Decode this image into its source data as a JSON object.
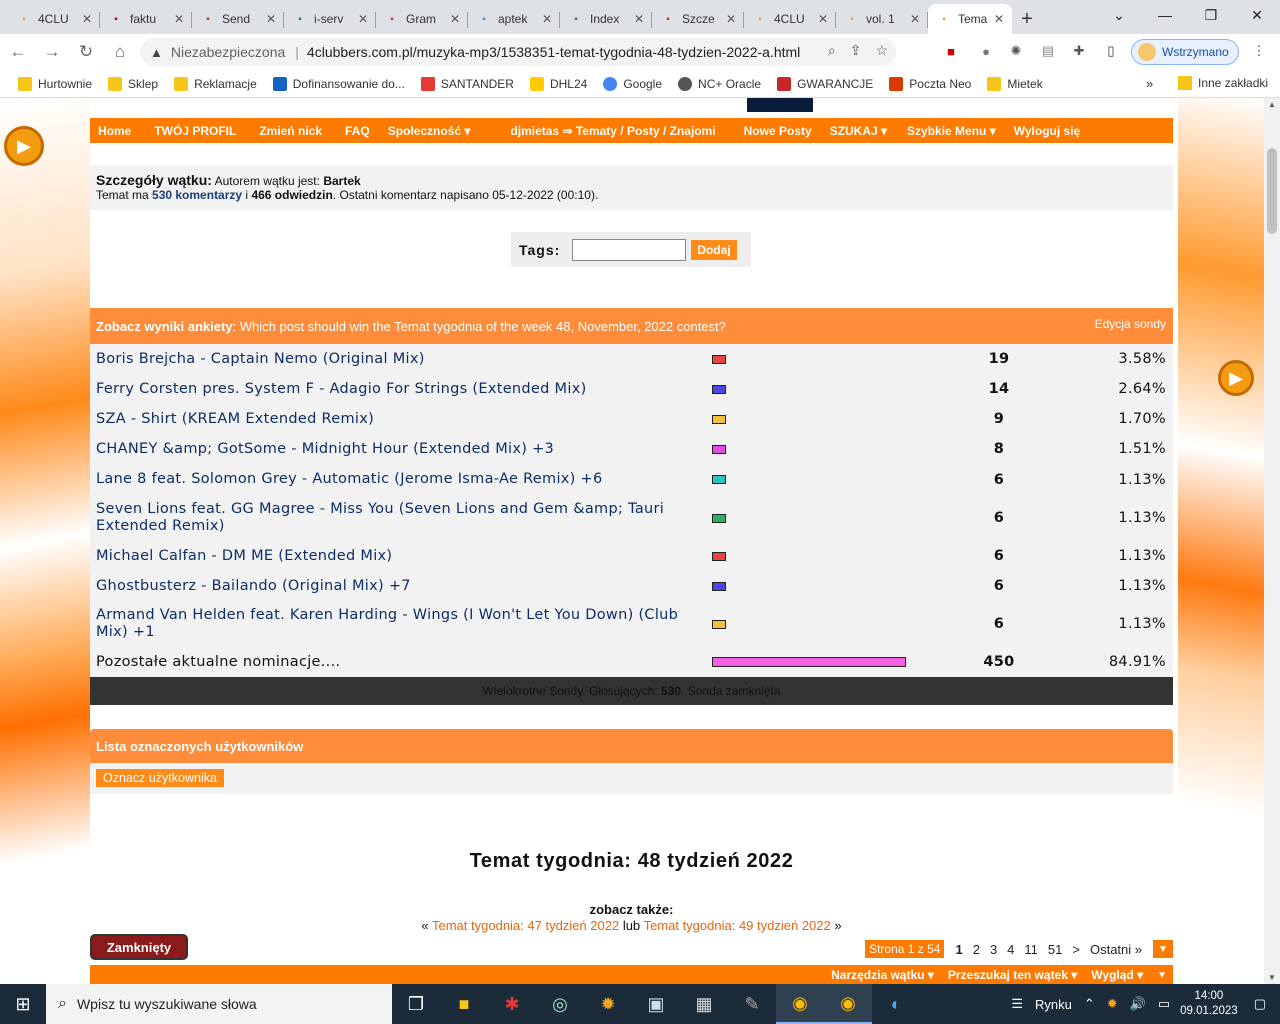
{
  "browser": {
    "tabs": [
      {
        "label": "4CLU",
        "icon": "4clubbers-favicon",
        "color": "#f5a623",
        "active": false
      },
      {
        "label": "faktu",
        "icon": "pdf-favicon",
        "color": "#c00000",
        "active": false
      },
      {
        "label": "Send",
        "icon": "sendit-favicon",
        "color": "#d32f2f",
        "active": false
      },
      {
        "label": "i-serv",
        "icon": "iserwis-favicon",
        "color": "#1a8f3c",
        "active": false
      },
      {
        "label": "Gram",
        "icon": "gram-favicon",
        "color": "#e53935",
        "active": false
      },
      {
        "label": "aptek",
        "icon": "google-favicon",
        "color": "#4285f4",
        "active": false
      },
      {
        "label": "Index",
        "icon": "globe-favicon",
        "color": "#666666",
        "active": false
      },
      {
        "label": "Szcze",
        "icon": "sendit-favicon",
        "color": "#d32f2f",
        "active": false
      },
      {
        "label": "4CLU",
        "icon": "4clubbers-favicon",
        "color": "#f5a623",
        "active": false
      },
      {
        "label": "vol. 1",
        "icon": "4clubbers-favicon",
        "color": "#f5a623",
        "active": false
      },
      {
        "label": "Tema",
        "icon": "4clubbers-favicon",
        "color": "#f5a623",
        "active": true
      }
    ],
    "new_tab": "+",
    "omnibox": {
      "security": "Niezabezpieczona",
      "url": "4clubbers.com.pl/muzyka-mp3/1538351-temat-tygodnia-48-tydzien-2022-a.html"
    },
    "profile_label": "Wstrzymano",
    "bookmarks": [
      {
        "label": "Hurtownie",
        "icon": "folder-icon"
      },
      {
        "label": "Sklep",
        "icon": "folder-icon"
      },
      {
        "label": "Reklamacje",
        "icon": "folder-icon"
      },
      {
        "label": "Dofinansowanie do...",
        "icon": "site-icon"
      },
      {
        "label": "SANTANDER",
        "icon": "santander-icon"
      },
      {
        "label": "DHL24",
        "icon": "dhl-icon"
      },
      {
        "label": "Google",
        "icon": "google-icon"
      },
      {
        "label": "NC+ Oracle",
        "icon": "globe-icon"
      },
      {
        "label": "GWARANCJE",
        "icon": "ergo-icon"
      },
      {
        "label": "Poczta Neo",
        "icon": "office-icon"
      },
      {
        "label": "Mietek",
        "icon": "folder-icon"
      }
    ],
    "bookmarks_more": "»",
    "other_bookmarks": "Inne zakładki"
  },
  "site": {
    "menu": [
      "Home",
      "TWÓJ PROFIL",
      "Zmień nick",
      "FAQ",
      "Społeczność ▾",
      "djmietas ⇒ Tematy / Posty / Znajomi",
      "Nowe Posty",
      "SZUKAJ ▾",
      "Szybkie Menu ▾",
      "Wyloguj się"
    ],
    "details": {
      "heading": "Szczegóły wątku:",
      "author_prefix": "Autorem wątku jest:",
      "author": "Bartek",
      "line2_prefix": "Temat ma",
      "comments": "530 komentarzy",
      "and": "i",
      "visits": "466 odwiedzin",
      "line2_suffix": ". Ostatni komentarz napisano 05-12-2022 (00:10)."
    },
    "tags": {
      "label": "Tags:",
      "button": "Dodaj",
      "value": ""
    },
    "poll": {
      "heading_bold": "Zobacz wyniki ankiety",
      "question": ": Which post should win the Temat tygodnia of the week 48, November, 2022 contest?",
      "edit": "Edycja sondy",
      "options": [
        {
          "label": "Boris Brejcha - Captain Nemo (Original Mix)",
          "votes": "19",
          "percent": "3.58%",
          "share": 0.0358,
          "color": "#e04848"
        },
        {
          "label": "Ferry Corsten pres. System F - Adagio For Strings (Extended Mix)",
          "votes": "14",
          "percent": "2.64%",
          "share": 0.0264,
          "color": "#4848e0"
        },
        {
          "label": "SZA - Shirt (KREAM Extended Remix)",
          "votes": "9",
          "percent": "1.70%",
          "share": 0.017,
          "color": "#f0c040"
        },
        {
          "label": "CHANEY &amp; GotSome - Midnight Hour (Extended Mix) +3",
          "votes": "8",
          "percent": "1.51%",
          "share": 0.0151,
          "color": "#e050e0"
        },
        {
          "label": "Lane 8 feat. Solomon Grey - Automatic (Jerome Isma-Ae Remix) +6",
          "votes": "6",
          "percent": "1.13%",
          "share": 0.0113,
          "color": "#30c0c0"
        },
        {
          "label": "Seven Lions feat. GG Magree - Miss You (Seven Lions and Gem &amp; Tauri Extended Remix)",
          "votes": "6",
          "percent": "1.13%",
          "share": 0.0113,
          "color": "#30b060"
        },
        {
          "label": "Michael Calfan - DM ME (Extended Mix)",
          "votes": "6",
          "percent": "1.13%",
          "share": 0.0113,
          "color": "#e04848"
        },
        {
          "label": "Ghostbusterz - Bailando (Original Mix) +7",
          "votes": "6",
          "percent": "1.13%",
          "share": 0.0113,
          "color": "#4848e0"
        },
        {
          "label": "Armand Van Helden feat. Karen Harding - Wings (I Won't Let You Down) (Club Mix) +1",
          "votes": "6",
          "percent": "1.13%",
          "share": 0.0113,
          "color": "#f0c040"
        },
        {
          "label": "Pozostałe aktualne nominacje....",
          "votes": "450",
          "percent": "84.91%",
          "share": 0.8491,
          "color": "#f060e0",
          "plain": true
        }
      ],
      "footer_prefix": "Wielokrotne Sondy. Głosujących:",
      "footer_voters": "530",
      "footer_suffix": ". Sonda zamknięta"
    },
    "tagged_users": {
      "heading": "Lista oznaczonych użytkowników",
      "button": "Oznacz użytkownika"
    },
    "thread_title": "Temat tygodnia: 48 tydzień 2022",
    "see_also": {
      "label": "zobacz także:",
      "open": "«",
      "prev": "Temat tygodnia: 47 tydzień 2022",
      "or": "lub",
      "next": "Temat tygodnia: 49 tydzień 2022",
      "close": "»"
    },
    "closed_button": "Zamknięty",
    "pager": {
      "info": "Strona 1 z 54",
      "pages": [
        "1",
        "2",
        "3",
        "4",
        "11",
        "51",
        ">",
        "Ostatni »"
      ],
      "current": "1"
    },
    "thread_tools": [
      "Narzędzia wątku ▾",
      "Przeszukaj ten wątek ▾",
      "Wygląd ▾"
    ]
  },
  "taskbar": {
    "search_placeholder": "Wpisz tu wyszukiwane słowa",
    "weather": "Rynku",
    "time": "14:00",
    "date": "09.01.2023"
  }
}
